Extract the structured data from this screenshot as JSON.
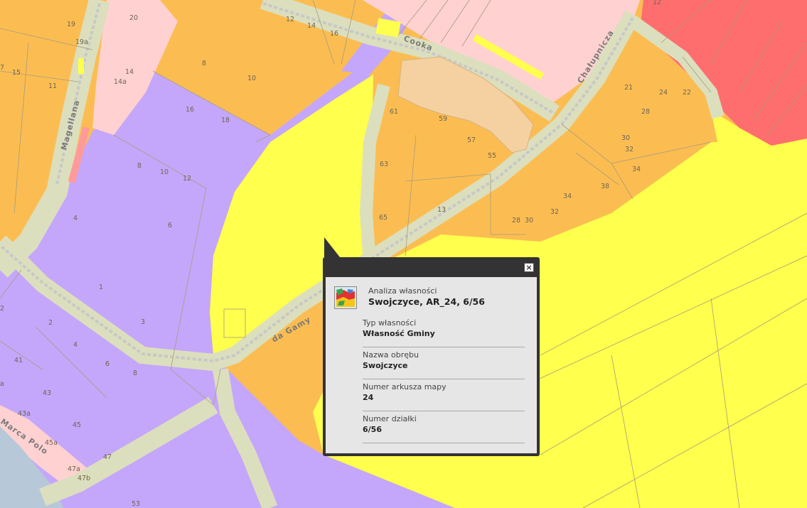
{
  "map": {
    "streets": [
      {
        "id": "magellana",
        "text": "Magellana"
      },
      {
        "id": "cooka",
        "text": "Cooka"
      },
      {
        "id": "chalupnicza",
        "text": "Chałupnicza"
      },
      {
        "id": "da-gamy",
        "text": "da Gamy"
      },
      {
        "id": "marca-polo",
        "text": "Marca Polo"
      }
    ],
    "parcel_labels": [
      "20",
      "19",
      "19a",
      "7",
      "15",
      "11",
      "14",
      "14a",
      "12",
      "14",
      "16",
      "8",
      "10",
      "16",
      "18",
      "8",
      "10",
      "12",
      "4",
      "6",
      "1",
      "2",
      "3",
      "2",
      "4",
      "41",
      "6",
      "8",
      "43",
      "43a",
      "45",
      "45a",
      "47",
      "47a",
      "47b",
      "53",
      "61",
      "59",
      "57",
      "55",
      "63",
      "65",
      "13",
      "21",
      "24",
      "22",
      "28",
      "30",
      "32",
      "34",
      "38",
      "34",
      "32",
      "28",
      "30",
      "12",
      "a"
    ],
    "colors": {
      "orange": "#fbbd52",
      "purple": "#c4a7fb",
      "yellow": "#ffff4d",
      "pink": "#ffd1d1",
      "red": "#ff6e6e",
      "road": "#dcdfbd",
      "water": "#b7c8d8",
      "building": "#f5d1a1"
    }
  },
  "popup": {
    "subtitle": "Analiza własności",
    "title": "Swojczyce, AR_24, 6/56",
    "close_glyph": "×",
    "fields": [
      {
        "label": "Typ własności",
        "value": "Własność Gminy"
      },
      {
        "label": "Nazwa obrębu",
        "value": "Swojczyce"
      },
      {
        "label": "Numer arkusza mapy",
        "value": "24"
      },
      {
        "label": "Numer działki",
        "value": "6/56"
      }
    ]
  }
}
